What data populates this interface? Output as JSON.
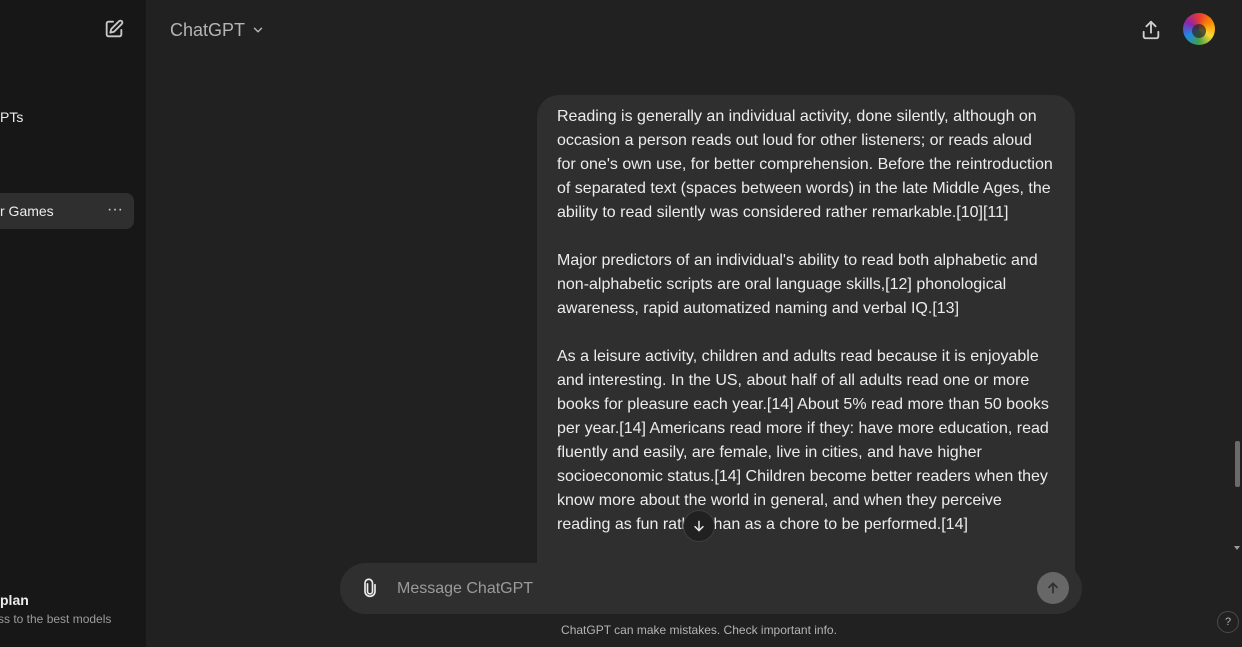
{
  "sidebar": {
    "gpts_label": "PTs",
    "active_chat_label": "r Games",
    "more_label": "···",
    "upgrade_title": "plan",
    "upgrade_subtitle": "ss to the best models"
  },
  "header": {
    "model_name": "ChatGPT"
  },
  "conversation": {
    "user_message_paragraphs": [
      "Reading is generally an individual activity, done silently, although on occasion a person reads out loud for other listeners; or reads aloud for one's own use, for better comprehension. Before the reintroduction of separated text (spaces between words) in the late Middle Ages, the ability to read silently was considered rather remarkable.[10][11]",
      "Major predictors of an individual's ability to read both alphabetic and non-alphabetic scripts are oral language skills,[12] phonological awareness, rapid automatized naming and verbal IQ.[13]",
      "As a leisure activity, children and adults read because it is enjoyable and interesting. In the US, about half of all adults read one or more books for pleasure each year.[14] About 5% read more than 50 books per year.[14] Americans read more if they: have more education, read fluently and easily, are female, live in cities, and have higher socioeconomic status.[14] Children become better readers when they know more about the world in general, and when they perceive reading as fun rather than as a chore to be performed.[14]"
    ]
  },
  "composer": {
    "placeholder": "Message ChatGPT",
    "value": ""
  },
  "footer": {
    "disclaimer": "ChatGPT can make mistakes. Check important info.",
    "help_label": "?"
  },
  "colors": {
    "background": "#212121",
    "sidebar": "#171717",
    "bubble": "#2f2f2f",
    "text": "#ececec",
    "muted": "#b4b4b4"
  },
  "icons": {
    "new_chat": "edit-icon",
    "model_chevron": "chevron-down-icon",
    "share": "share-icon",
    "attach": "paperclip-icon",
    "send": "arrow-up-icon",
    "scroll_down": "arrow-down-icon"
  }
}
